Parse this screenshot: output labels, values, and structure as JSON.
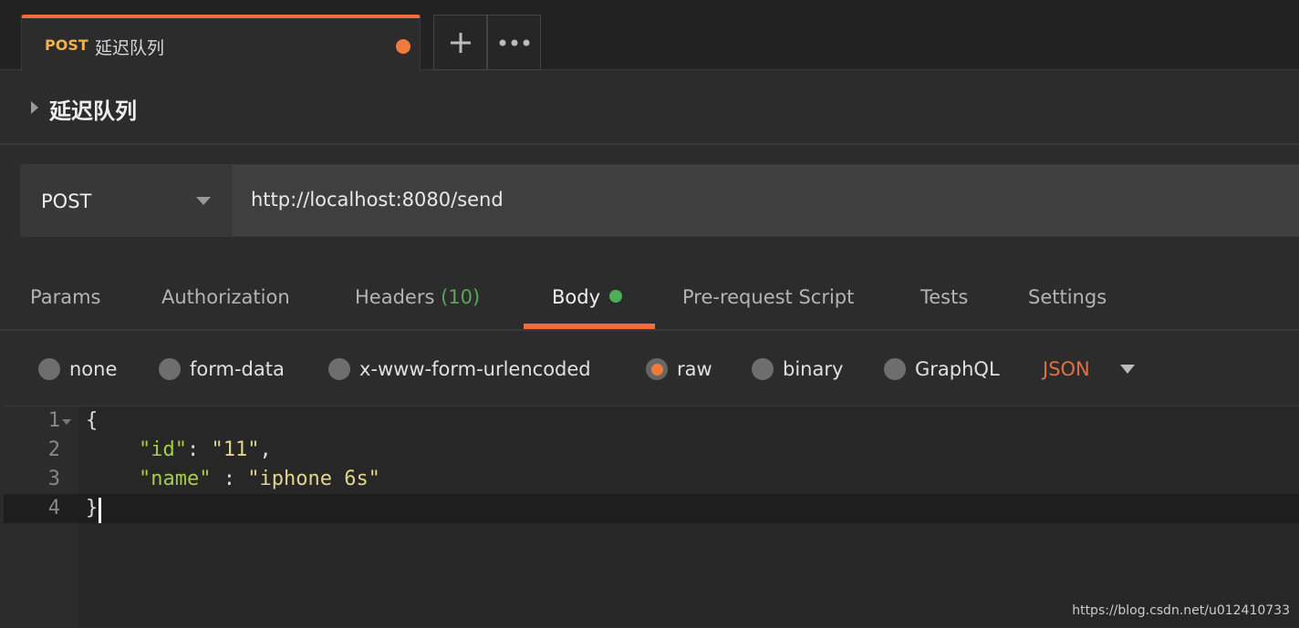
{
  "tab": {
    "method": "POST",
    "title": "延迟队列",
    "unsaved_color": "#ef7a3b"
  },
  "toolbar": {
    "new_tab_icon": "plus-icon",
    "more_icon": "ellipsis-icon"
  },
  "request": {
    "name": "延迟队列",
    "method": "POST",
    "url": "http://localhost:8080/send"
  },
  "tabs": [
    {
      "label": "Params"
    },
    {
      "label": "Authorization"
    },
    {
      "label": "Headers",
      "count": "(10)"
    },
    {
      "label": "Body",
      "active": true
    },
    {
      "label": "Pre-request Script"
    },
    {
      "label": "Tests"
    },
    {
      "label": "Settings"
    }
  ],
  "body_types": [
    {
      "label": "none"
    },
    {
      "label": "form-data"
    },
    {
      "label": "x-www-form-urlencoded"
    },
    {
      "label": "raw",
      "selected": true
    },
    {
      "label": "binary"
    },
    {
      "label": "GraphQL"
    }
  ],
  "format": "JSON",
  "editor": {
    "lines": [
      "1",
      "2",
      "3",
      "4"
    ],
    "l1": "{",
    "l2_key": "\"id\"",
    "l2_sep": ": ",
    "l2_val": "\"11\"",
    "l2_end": ",",
    "l3_key": "\"name\"",
    "l3_sep": " : ",
    "l3_val": "\"iphone 6s\"",
    "l4": "}"
  },
  "watermark": "https://blog.csdn.net/u012410733",
  "colors": {
    "accent": "#f26b3a",
    "method_tab": "#f0b14a",
    "json_key": "#a9cc45",
    "json_string": "#e1d58a",
    "active_dot": "#4cae57"
  }
}
